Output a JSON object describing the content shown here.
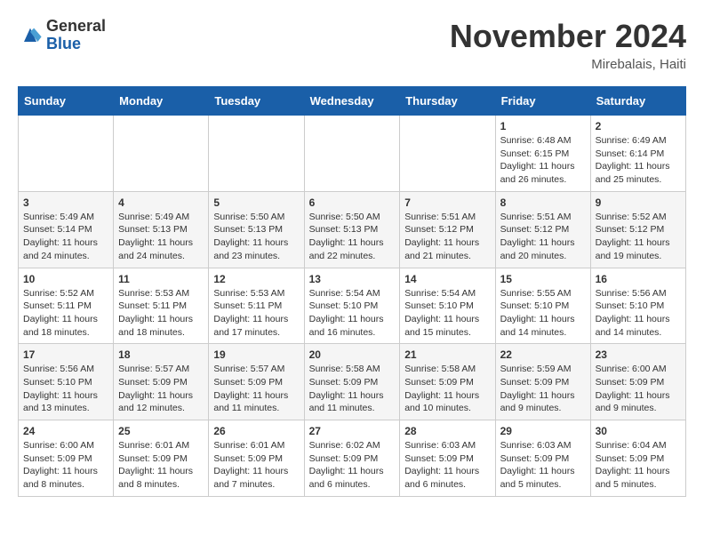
{
  "header": {
    "logo_general": "General",
    "logo_blue": "Blue",
    "month_title": "November 2024",
    "location": "Mirebalais, Haiti"
  },
  "calendar": {
    "days_of_week": [
      "Sunday",
      "Monday",
      "Tuesday",
      "Wednesday",
      "Thursday",
      "Friday",
      "Saturday"
    ],
    "weeks": [
      [
        {
          "day": "",
          "info": ""
        },
        {
          "day": "",
          "info": ""
        },
        {
          "day": "",
          "info": ""
        },
        {
          "day": "",
          "info": ""
        },
        {
          "day": "",
          "info": ""
        },
        {
          "day": "1",
          "info": "Sunrise: 6:48 AM\nSunset: 6:15 PM\nDaylight: 11 hours\nand 26 minutes."
        },
        {
          "day": "2",
          "info": "Sunrise: 6:49 AM\nSunset: 6:14 PM\nDaylight: 11 hours\nand 25 minutes."
        }
      ],
      [
        {
          "day": "3",
          "info": "Sunrise: 5:49 AM\nSunset: 5:14 PM\nDaylight: 11 hours\nand 24 minutes."
        },
        {
          "day": "4",
          "info": "Sunrise: 5:49 AM\nSunset: 5:13 PM\nDaylight: 11 hours\nand 24 minutes."
        },
        {
          "day": "5",
          "info": "Sunrise: 5:50 AM\nSunset: 5:13 PM\nDaylight: 11 hours\nand 23 minutes."
        },
        {
          "day": "6",
          "info": "Sunrise: 5:50 AM\nSunset: 5:13 PM\nDaylight: 11 hours\nand 22 minutes."
        },
        {
          "day": "7",
          "info": "Sunrise: 5:51 AM\nSunset: 5:12 PM\nDaylight: 11 hours\nand 21 minutes."
        },
        {
          "day": "8",
          "info": "Sunrise: 5:51 AM\nSunset: 5:12 PM\nDaylight: 11 hours\nand 20 minutes."
        },
        {
          "day": "9",
          "info": "Sunrise: 5:52 AM\nSunset: 5:12 PM\nDaylight: 11 hours\nand 19 minutes."
        }
      ],
      [
        {
          "day": "10",
          "info": "Sunrise: 5:52 AM\nSunset: 5:11 PM\nDaylight: 11 hours\nand 18 minutes."
        },
        {
          "day": "11",
          "info": "Sunrise: 5:53 AM\nSunset: 5:11 PM\nDaylight: 11 hours\nand 18 minutes."
        },
        {
          "day": "12",
          "info": "Sunrise: 5:53 AM\nSunset: 5:11 PM\nDaylight: 11 hours\nand 17 minutes."
        },
        {
          "day": "13",
          "info": "Sunrise: 5:54 AM\nSunset: 5:10 PM\nDaylight: 11 hours\nand 16 minutes."
        },
        {
          "day": "14",
          "info": "Sunrise: 5:54 AM\nSunset: 5:10 PM\nDaylight: 11 hours\nand 15 minutes."
        },
        {
          "day": "15",
          "info": "Sunrise: 5:55 AM\nSunset: 5:10 PM\nDaylight: 11 hours\nand 14 minutes."
        },
        {
          "day": "16",
          "info": "Sunrise: 5:56 AM\nSunset: 5:10 PM\nDaylight: 11 hours\nand 14 minutes."
        }
      ],
      [
        {
          "day": "17",
          "info": "Sunrise: 5:56 AM\nSunset: 5:10 PM\nDaylight: 11 hours\nand 13 minutes."
        },
        {
          "day": "18",
          "info": "Sunrise: 5:57 AM\nSunset: 5:09 PM\nDaylight: 11 hours\nand 12 minutes."
        },
        {
          "day": "19",
          "info": "Sunrise: 5:57 AM\nSunset: 5:09 PM\nDaylight: 11 hours\nand 11 minutes."
        },
        {
          "day": "20",
          "info": "Sunrise: 5:58 AM\nSunset: 5:09 PM\nDaylight: 11 hours\nand 11 minutes."
        },
        {
          "day": "21",
          "info": "Sunrise: 5:58 AM\nSunset: 5:09 PM\nDaylight: 11 hours\nand 10 minutes."
        },
        {
          "day": "22",
          "info": "Sunrise: 5:59 AM\nSunset: 5:09 PM\nDaylight: 11 hours\nand 9 minutes."
        },
        {
          "day": "23",
          "info": "Sunrise: 6:00 AM\nSunset: 5:09 PM\nDaylight: 11 hours\nand 9 minutes."
        }
      ],
      [
        {
          "day": "24",
          "info": "Sunrise: 6:00 AM\nSunset: 5:09 PM\nDaylight: 11 hours\nand 8 minutes."
        },
        {
          "day": "25",
          "info": "Sunrise: 6:01 AM\nSunset: 5:09 PM\nDaylight: 11 hours\nand 8 minutes."
        },
        {
          "day": "26",
          "info": "Sunrise: 6:01 AM\nSunset: 5:09 PM\nDaylight: 11 hours\nand 7 minutes."
        },
        {
          "day": "27",
          "info": "Sunrise: 6:02 AM\nSunset: 5:09 PM\nDaylight: 11 hours\nand 6 minutes."
        },
        {
          "day": "28",
          "info": "Sunrise: 6:03 AM\nSunset: 5:09 PM\nDaylight: 11 hours\nand 6 minutes."
        },
        {
          "day": "29",
          "info": "Sunrise: 6:03 AM\nSunset: 5:09 PM\nDaylight: 11 hours\nand 5 minutes."
        },
        {
          "day": "30",
          "info": "Sunrise: 6:04 AM\nSunset: 5:09 PM\nDaylight: 11 hours\nand 5 minutes."
        }
      ]
    ]
  }
}
